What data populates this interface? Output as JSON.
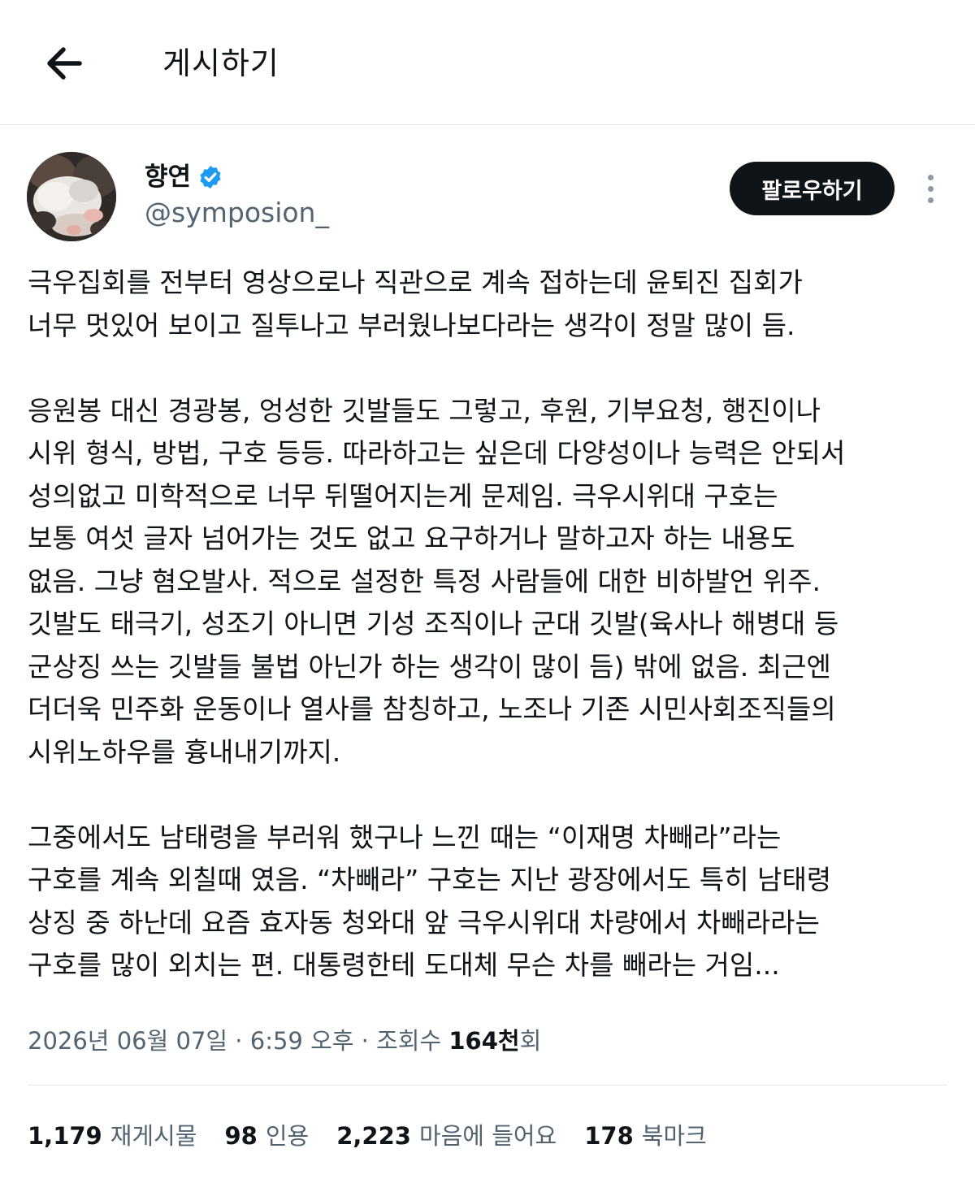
{
  "header": {
    "title": "게시하기",
    "back_icon": "arrow-left-icon"
  },
  "author": {
    "name": "향연",
    "handle": "@symposion_",
    "verified": true,
    "verified_color": "#1d9bf0"
  },
  "actions": {
    "follow_label": "팔로우하기",
    "more_icon": "more-vertical-icon"
  },
  "post": {
    "lines": [
      "극우집회를 전부터 영상으로나 직관으로 계속 접하는데 윤퇴진 집회가",
      "너무 멋있어 보이고 질투나고 부러웠나보다라는 생각이 정말 많이 듬.",
      "",
      "응원봉 대신 경광봉, 엉성한 깃발들도 그렇고, 후원, 기부요청, 행진이나",
      "시위 형식, 방법, 구호 등등. 따라하고는 싶은데 다양성이나 능력은 안되서",
      "성의없고 미학적으로 너무 뒤떨어지는게 문제임. 극우시위대 구호는",
      "보통 여섯 글자 넘어가는 것도 없고 요구하거나 말하고자 하는 내용도",
      "없음. 그냥 혐오발사. 적으로 설정한 특정 사람들에 대한 비하발언 위주.",
      "깃발도 태극기, 성조기 아니면 기성 조직이나 군대 깃발(육사나 해병대 등",
      "군상징 쓰는 깃발들 불법 아닌가 하는 생각이 많이 듬) 밖에 없음. 최근엔",
      "더더욱 민주화 운동이나 열사를 참칭하고, 노조나 기존 시민사회조직들의",
      "시위노하우를 흉내내기까지.",
      "",
      "그중에서도 남태령을 부러워 했구나 느낀 때는 “이재명 차빼라”라는",
      "구호를 계속 외칠때 였음. “차빼라” 구호는 지난 광장에서도 특히 남태령",
      "상징 중 하난데 요즘 효자동 청와대 앞 극우시위대 차량에서 차빼라라는",
      "구호를 많이 외치는 편. 대통령한테 도대체 무슨 차를 빼라는 거임..."
    ]
  },
  "meta": {
    "date": "2026년 06월 07일",
    "separator": " · ",
    "time": "6:59 오후",
    "views_label": "조회수 ",
    "views_value": "164천",
    "views_suffix": "회"
  },
  "stats": [
    {
      "value": "1,179",
      "label": "재게시물"
    },
    {
      "value": "98",
      "label": "인용"
    },
    {
      "value": "2,223",
      "label": "마음에 들어요"
    },
    {
      "value": "178",
      "label": "북마크"
    }
  ]
}
